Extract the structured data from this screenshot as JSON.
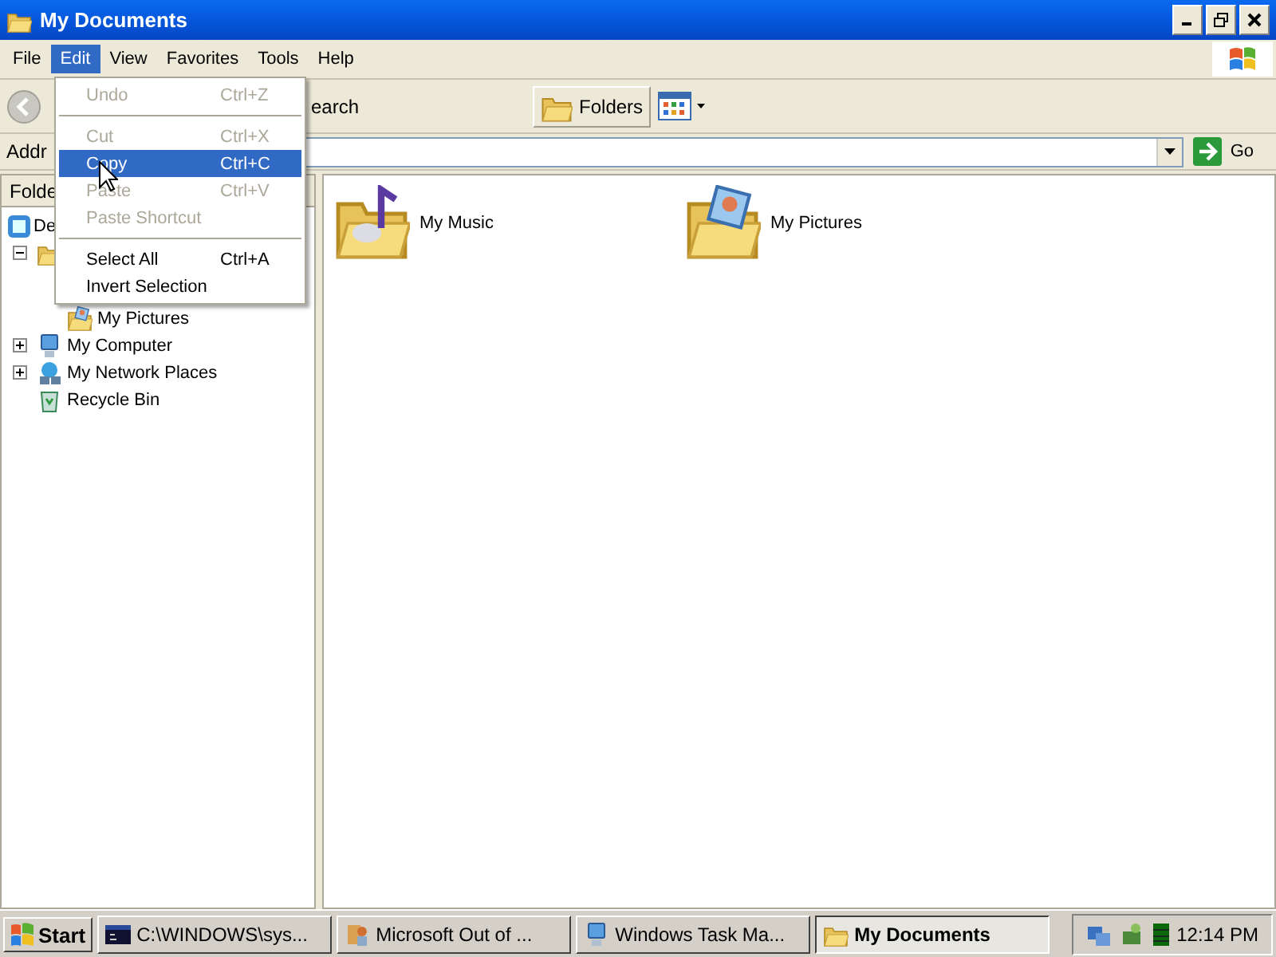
{
  "window": {
    "title": "My Documents"
  },
  "menu_bar": [
    {
      "label": "File",
      "selected": false
    },
    {
      "label": "Edit",
      "selected": true
    },
    {
      "label": "View",
      "selected": false
    },
    {
      "label": "Favorites",
      "selected": false
    },
    {
      "label": "Tools",
      "selected": false
    },
    {
      "label": "Help",
      "selected": false
    }
  ],
  "edit_menu": [
    {
      "kind": "item",
      "label": "Undo",
      "shortcut": "Ctrl+Z",
      "disabled": true,
      "selected": false
    },
    {
      "kind": "separator"
    },
    {
      "kind": "item",
      "label": "Cut",
      "shortcut": "Ctrl+X",
      "disabled": true,
      "selected": false
    },
    {
      "kind": "item",
      "label": "Copy",
      "shortcut": "Ctrl+C",
      "disabled": false,
      "selected": true
    },
    {
      "kind": "item",
      "label": "Paste",
      "shortcut": "Ctrl+V",
      "disabled": true,
      "selected": false
    },
    {
      "kind": "item",
      "label": "Paste Shortcut",
      "disabled": true,
      "selected": false
    },
    {
      "kind": "separator"
    },
    {
      "kind": "item",
      "label": "Select All",
      "shortcut": "Ctrl+A",
      "disabled": false,
      "selected": false
    },
    {
      "kind": "item",
      "label": "Invert Selection",
      "disabled": false,
      "selected": false
    }
  ],
  "toolbar": [
    {
      "kind": "back"
    },
    {
      "kind": "search",
      "label": "earch"
    },
    {
      "kind": "folders",
      "label": "Folders"
    },
    {
      "kind": "views"
    }
  ],
  "address_bar": {
    "label": "Addr",
    "go": "Go"
  },
  "folders_pane": {
    "title": "Folde",
    "tree": [
      {
        "kind": "desktop",
        "label": "De",
        "children": [
          {
            "kind": "folder",
            "expandable": true,
            "expanded": true,
            "children": [
              {
                "kind": "pictures",
                "label": "My Pictures",
                "expandable": false
              }
            ]
          },
          {
            "kind": "computer",
            "label": "My Computer",
            "expandable": true,
            "expanded": false
          },
          {
            "kind": "network",
            "label": "My Network Places",
            "expandable": true,
            "expanded": false
          },
          {
            "kind": "recycle",
            "label": "Recycle Bin",
            "expandable": false
          }
        ]
      }
    ]
  },
  "content": [
    {
      "kind": "music",
      "label": "My Music"
    },
    {
      "kind": "pictures",
      "label": "My Pictures"
    }
  ],
  "taskbar": {
    "start": "Start",
    "tasks": [
      {
        "kind": "console",
        "label": "C:\\WINDOWS\\sys...",
        "selected": false
      },
      {
        "kind": "program",
        "label": "Microsoft Out of ...",
        "selected": false
      },
      {
        "kind": "computer",
        "label": "Windows Task Ma...",
        "selected": false
      },
      {
        "kind": "folder",
        "label": "My Documents",
        "selected": true
      }
    ],
    "clock": "12:14 PM"
  }
}
